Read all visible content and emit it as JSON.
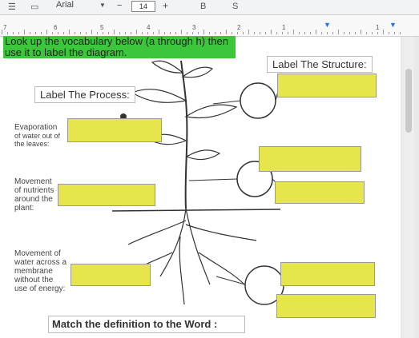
{
  "toolbar": {
    "font_name": "Arial",
    "font_size": "14",
    "minus": "−",
    "plus": "+"
  },
  "ruler": {
    "numbers": [
      "7",
      "6",
      "5",
      "4",
      "3",
      "2",
      "1",
      "1"
    ]
  },
  "worksheet": {
    "instructions": "Look up the vocabulary below (a through h) then use it to label the diagram.",
    "label_structure_heading": "Label The Structure:",
    "label_process_heading": "Label The Process:",
    "process_labels": {
      "evaporation": "Evaporation",
      "evaporation_desc": "of water out of the leaves:",
      "movement_nutrients": "Movement of nutrients around the plant:",
      "movement_water": "Movement of water across a membrane without the use of energy:"
    },
    "footer": "Match the definition to the Word :"
  },
  "colors": {
    "highlight_green": "#3cc63c",
    "answer_box": "#e6e64c"
  }
}
